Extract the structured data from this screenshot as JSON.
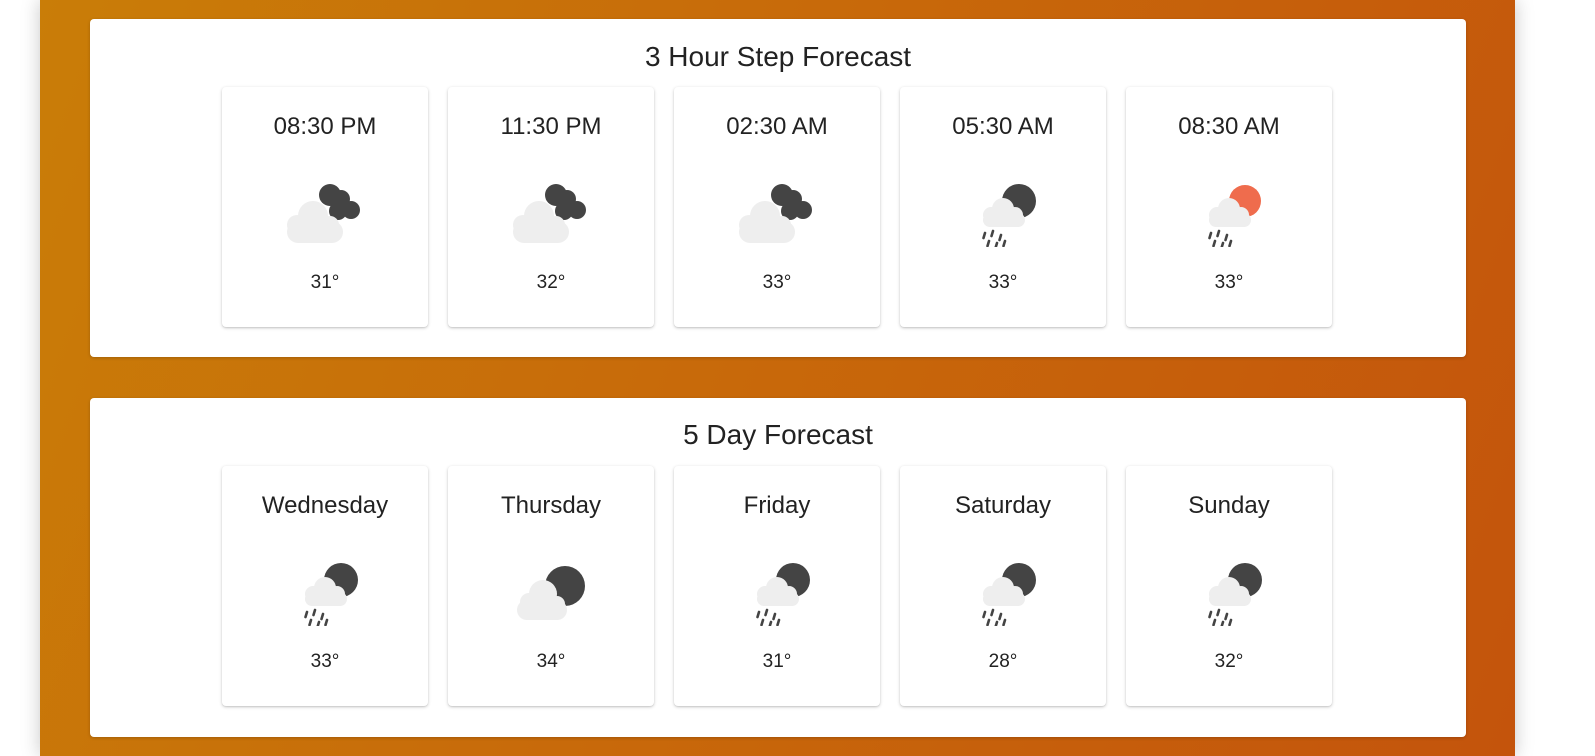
{
  "colors": {
    "background_gradient_start": "#c97d08",
    "background_gradient_end": "#c4540c",
    "card_background": "#ffffff",
    "cloud": "#eeeeee",
    "dark_cloud": "#444444",
    "moon": "#444444",
    "sun": "#ef6c4d",
    "rain": "#444444"
  },
  "hourly": {
    "title": "3 Hour Step Forecast",
    "items": [
      {
        "time": "08:30 PM",
        "icon": "cloudy-night-icon",
        "temp": "31°"
      },
      {
        "time": "11:30 PM",
        "icon": "cloudy-night-icon",
        "temp": "32°"
      },
      {
        "time": "02:30 AM",
        "icon": "cloudy-night-icon",
        "temp": "33°"
      },
      {
        "time": "05:30 AM",
        "icon": "rain-night-icon",
        "temp": "33°"
      },
      {
        "time": "08:30 AM",
        "icon": "rain-day-icon",
        "temp": "33°"
      }
    ]
  },
  "daily": {
    "title": "5 Day Forecast",
    "items": [
      {
        "day": "Wednesday",
        "icon": "rain-night-icon",
        "temp": "33°"
      },
      {
        "day": "Thursday",
        "icon": "partly-cloudy-night-icon",
        "temp": "34°"
      },
      {
        "day": "Friday",
        "icon": "rain-night-icon",
        "temp": "31°"
      },
      {
        "day": "Saturday",
        "icon": "rain-night-icon",
        "temp": "28°"
      },
      {
        "day": "Sunday",
        "icon": "rain-night-icon",
        "temp": "32°"
      }
    ]
  }
}
